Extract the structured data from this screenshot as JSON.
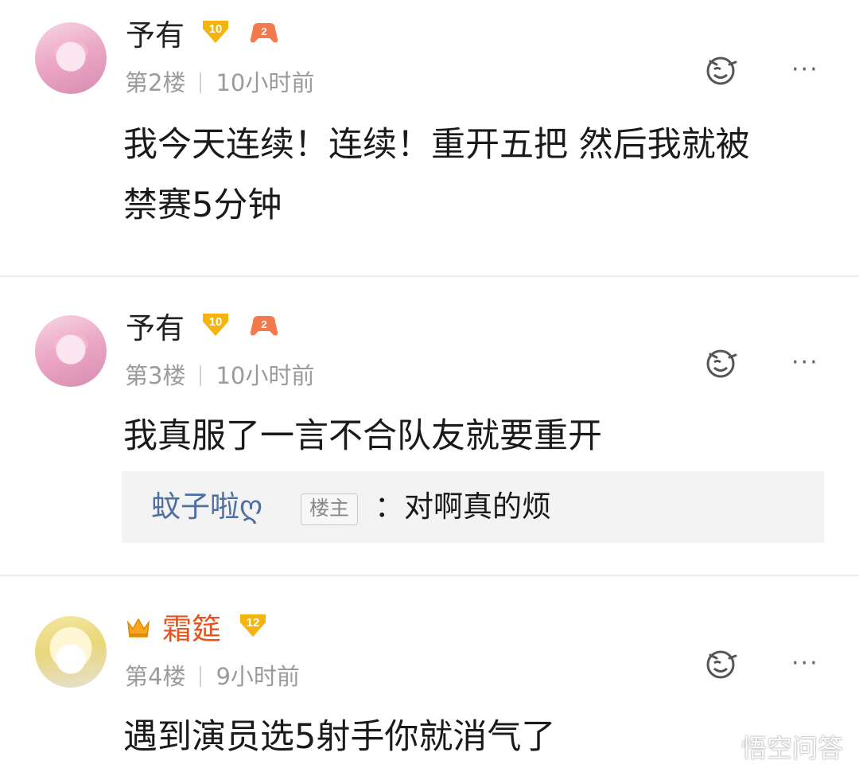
{
  "posts": [
    {
      "username": "予有",
      "level": "10",
      "game_badge": "2",
      "floor": "第2楼",
      "time": "10小时前",
      "content_line1": "我今天连续！连续！重开五把 然后我就被",
      "content_line2": "禁赛5分钟"
    },
    {
      "username": "予有",
      "level": "10",
      "game_badge": "2",
      "floor": "第3楼",
      "time": "10小时前",
      "content_line1": "我真服了一言不合队友就要重开",
      "reply": {
        "user": "蚊子啦ღ",
        "tag": "楼主",
        "text": "：对啊真的烦"
      }
    },
    {
      "username": "霜筵",
      "level": "12",
      "floor": "第4楼",
      "time": "9小时前",
      "content_line1": "遇到演员选5射手你就消气了"
    }
  ],
  "icons": {
    "reply_action": "emoji-face-icon",
    "more": "more-dots-icon",
    "crown": "crown-icon"
  },
  "colors": {
    "level_badge": "#f5b30e",
    "vip_name": "#e5541c",
    "reply_user": "#4f6fa3"
  },
  "more_label": "···",
  "watermark": "悟空问答"
}
